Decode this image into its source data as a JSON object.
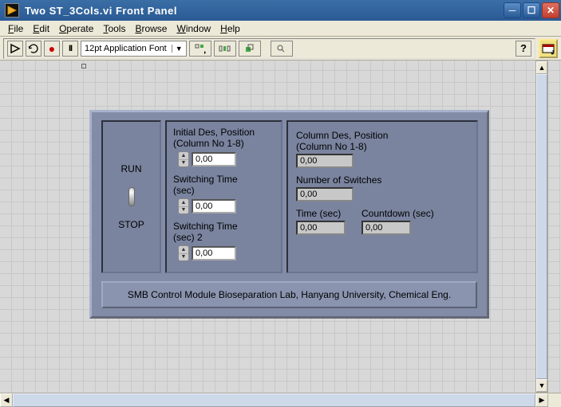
{
  "window": {
    "title": "Two ST_3Cols.vi Front Panel"
  },
  "menu": {
    "file": "File",
    "edit": "Edit",
    "operate": "Operate",
    "tools": "Tools",
    "browse": "Browse",
    "window": "Window",
    "help": "Help"
  },
  "toolbar": {
    "font": "12pt Application Font",
    "help": "?"
  },
  "left": {
    "run": "RUN",
    "stop": "STOP"
  },
  "mid": {
    "initpos_label1": "Initial Des, Position",
    "initpos_label2": "(Column No 1-8)",
    "initpos_val": "0,00",
    "swtime_label1": "Switching Time",
    "swtime_label2": "(sec)",
    "swtime_val": "0,00",
    "swtime2_label1": "Switching Time",
    "swtime2_label2": "(sec) 2",
    "swtime2_val": "0,00"
  },
  "right": {
    "colpos_label1": "Column Des, Position",
    "colpos_label2": "(Column No 1-8)",
    "colpos_val": "0,00",
    "nswitch_label": "Number of Switches",
    "nswitch_val": "0,00",
    "time_label": "Time (sec)",
    "time_val": "0,00",
    "countdown_label": "Countdown (sec)",
    "countdown_val": "0,00"
  },
  "footer": "SMB Control Module Bioseparation Lab, Hanyang University, Chemical Eng."
}
